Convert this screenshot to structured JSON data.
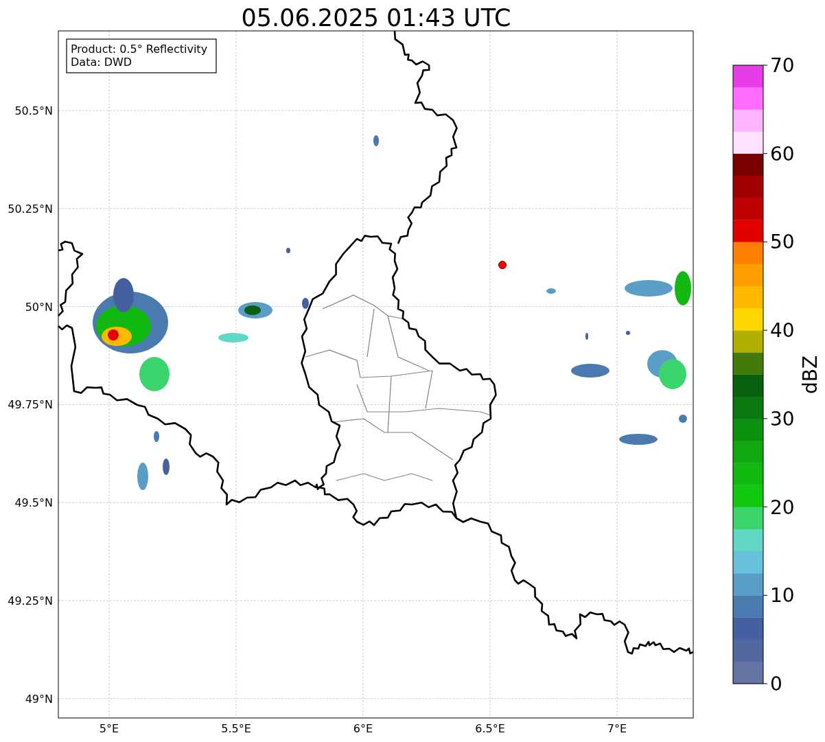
{
  "title": "05.06.2025 01:43 UTC",
  "info_box": [
    "Product: 0.5° Reflectivity",
    "Data: DWD"
  ],
  "lat_labels": [
    "50.5°N",
    "50.25°N",
    "50°N",
    "49.75°N",
    "49.5°N",
    "49.25°N",
    "49°N"
  ],
  "lon_labels": [
    "5°E",
    "5.5°E",
    "6°E",
    "6.5°E",
    "7°E"
  ],
  "colorbar": {
    "label": "dBZ",
    "ticks": [
      "70",
      "60",
      "50",
      "40",
      "30",
      "20",
      "10",
      "0"
    ],
    "bands": [
      {
        "color": "#6474a4"
      },
      {
        "color": "#5468a0"
      },
      {
        "color": "#4460a0"
      },
      {
        "color": "#4a7ab0"
      },
      {
        "color": "#5a9ec8"
      },
      {
        "color": "#66c2dc"
      },
      {
        "color": "#60d8c4"
      },
      {
        "color": "#3cd46c"
      },
      {
        "color": "#10c810"
      },
      {
        "color": "#10b810"
      },
      {
        "color": "#10a810"
      },
      {
        "color": "#0c9010"
      },
      {
        "color": "#0a7a10"
      },
      {
        "color": "#086010"
      },
      {
        "color": "#447a0a"
      },
      {
        "color": "#b0b000"
      },
      {
        "color": "#ffd700"
      },
      {
        "color": "#ffb800"
      },
      {
        "color": "#ff9c00"
      },
      {
        "color": "#ff8000"
      },
      {
        "color": "#e00000"
      },
      {
        "color": "#c00000"
      },
      {
        "color": "#a00000"
      },
      {
        "color": "#7a0000"
      },
      {
        "color": "#ffe0ff"
      },
      {
        "color": "#ffb4ff"
      },
      {
        "color": "#ff6cff"
      },
      {
        "color": "#e83ce8"
      }
    ]
  }
}
